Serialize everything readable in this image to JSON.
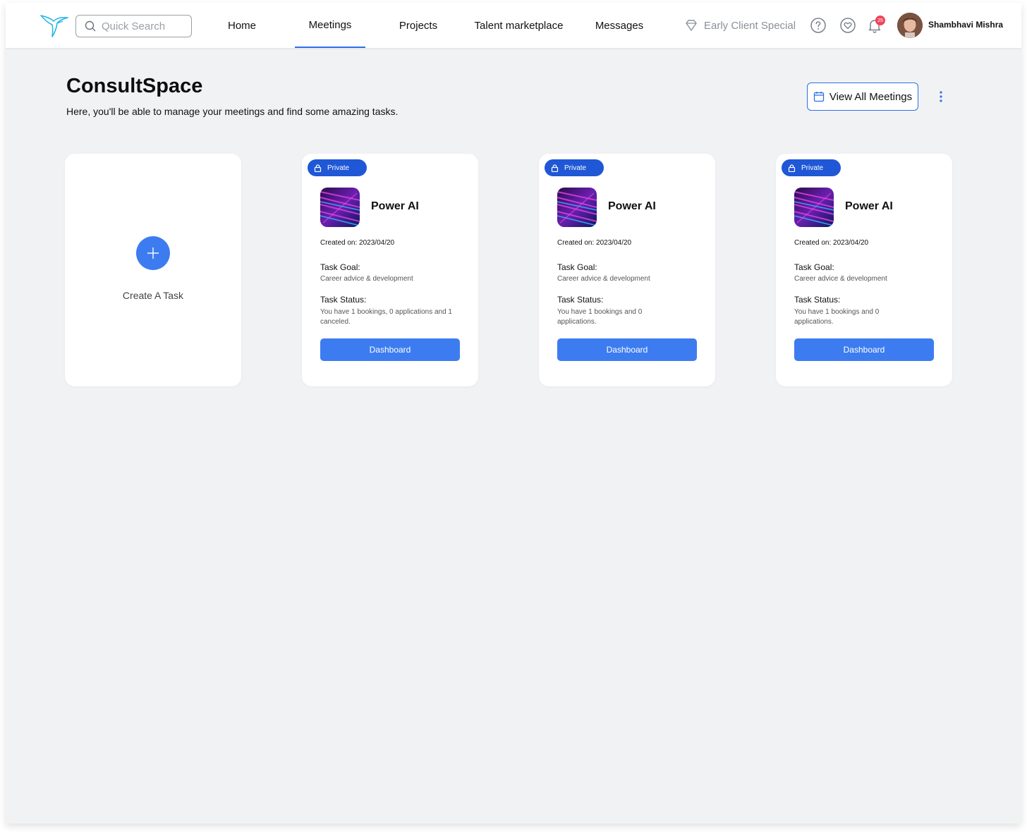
{
  "header": {
    "search_placeholder": "Quick Search",
    "nav": [
      {
        "label": "Home",
        "active": false
      },
      {
        "label": "Meetings",
        "active": true
      },
      {
        "label": "Projects",
        "active": false
      },
      {
        "label": "Talent marketplace",
        "active": false
      },
      {
        "label": "Messages",
        "active": false
      }
    ],
    "promo_label": "Early Client Special",
    "notification_count": "25",
    "user_name": "Shambhavi Mishra"
  },
  "page": {
    "title": "ConsultSpace",
    "subtitle": "Here, you'll be able to manage your meetings and find some amazing tasks.",
    "view_all_label": "View All Meetings"
  },
  "create_card": {
    "label": "Create A Task"
  },
  "cards": [
    {
      "badge": "Private",
      "name": "Power AI",
      "created_label": "Created on:",
      "created": "2023/04/20",
      "goal_heading": "Task Goal:",
      "goal": "Career advice & development",
      "status_heading": "Task Status:",
      "status": "You have 1 bookings, 0 applications and 1 canceled.",
      "button": "Dashboard"
    },
    {
      "badge": "Private",
      "name": "Power AI",
      "created_label": "Created on:",
      "created": "2023/04/20",
      "goal_heading": "Task Goal:",
      "goal": "Career advice & development",
      "status_heading": "Task Status:",
      "status": "You have 1 bookings and 0 applications.",
      "button": "Dashboard"
    },
    {
      "badge": "Private",
      "name": "Power AI",
      "created_label": "Created on:",
      "created": "2023/04/20",
      "goal_heading": "Task Goal:",
      "goal": "Career advice & development",
      "status_heading": "Task Status:",
      "status": "You have 1 bookings and 0 applications.",
      "button": "Dashboard"
    }
  ],
  "colors": {
    "accent": "#3d7cf0",
    "badge_blue": "#1f57d6",
    "notification_red": "#f0445b",
    "background": "#f1f2f4"
  }
}
